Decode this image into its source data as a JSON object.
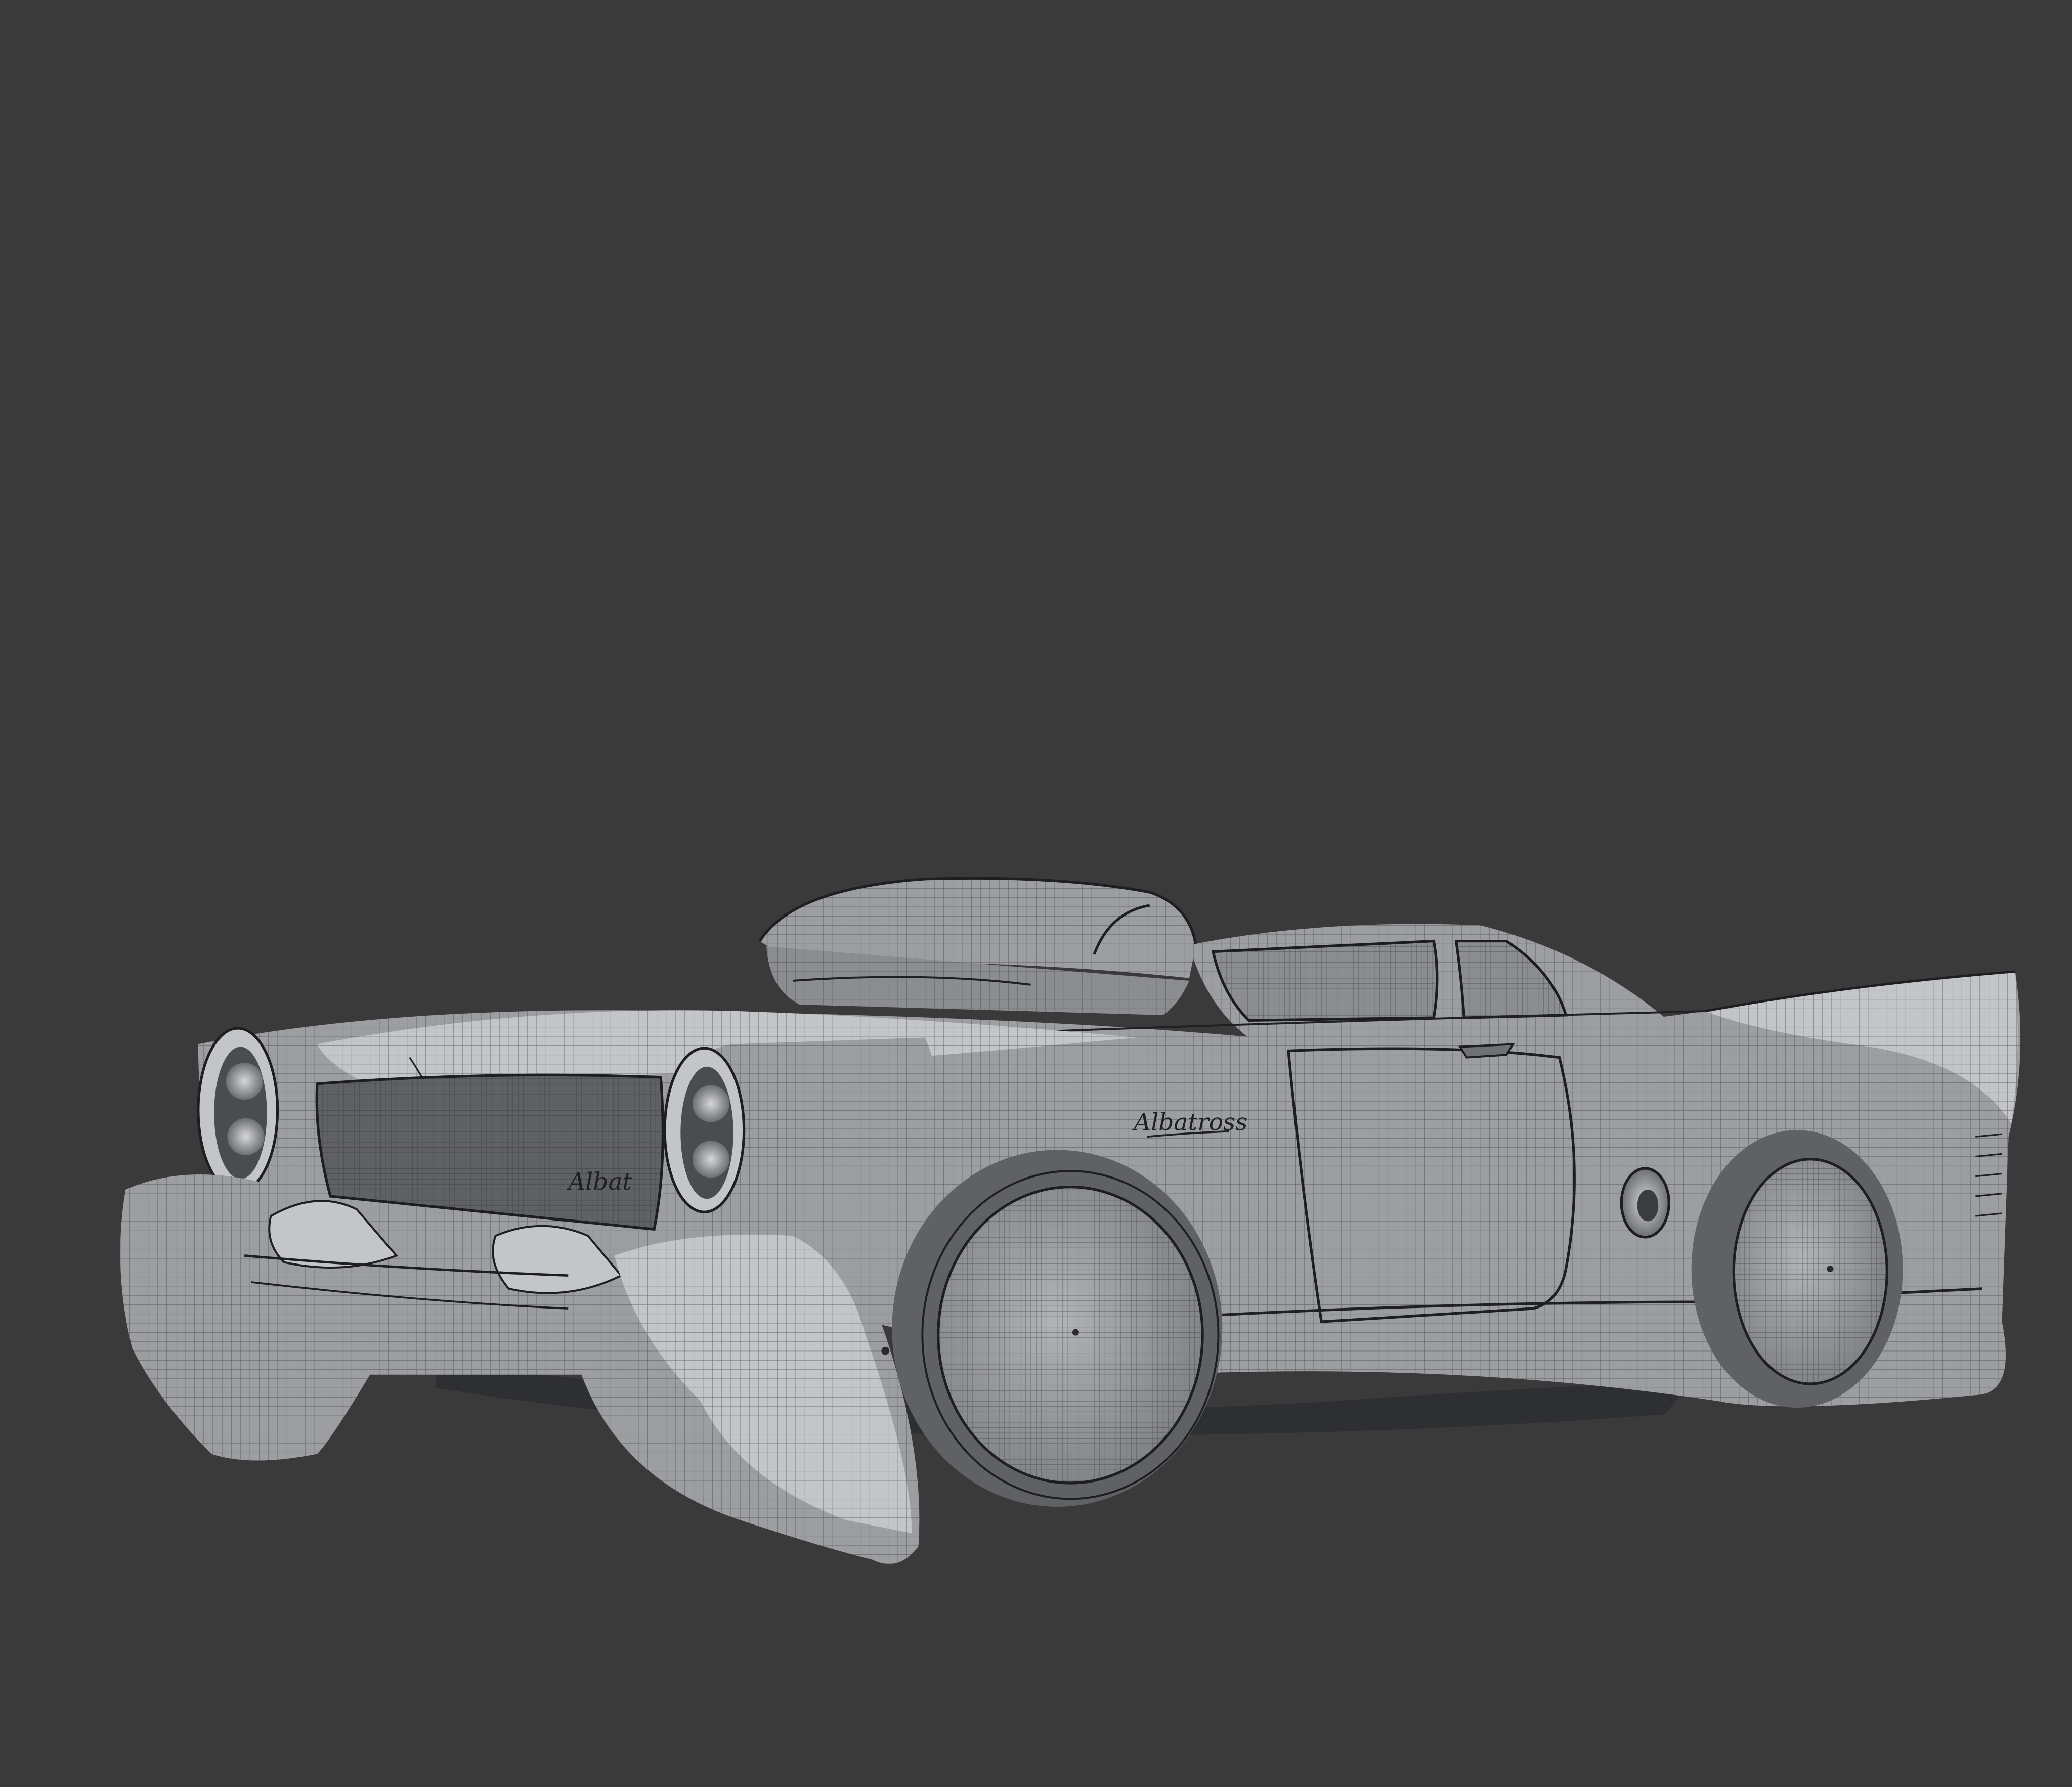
{
  "viewport": {
    "background": "#3a3a3a"
  },
  "model": {
    "body_color": "#9c9ea2",
    "shadow_color": "#5f6165",
    "highlight_color": "#c3c5c8",
    "wire_color": "#26282b",
    "glass_color": "#8b8d91"
  },
  "emblems": {
    "side": "Albatross",
    "grille": "Albat"
  }
}
